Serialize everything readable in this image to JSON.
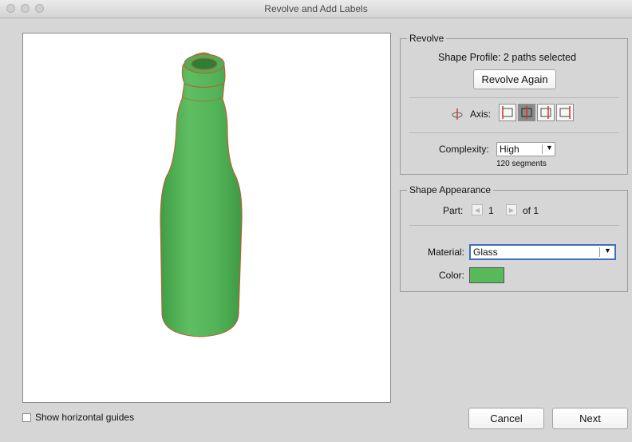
{
  "window": {
    "title": "Revolve and Add Labels"
  },
  "preview": {
    "show_guides_label": "Show horizontal guides",
    "show_guides_checked": false
  },
  "revolve": {
    "group_label": "Revolve",
    "shape_profile_text": "Shape Profile: 2 paths selected",
    "revolve_again_label": "Revolve Again",
    "axis_label": "Axis:",
    "axis_selected": 2,
    "complexity_label": "Complexity:",
    "complexity_value": "High",
    "segments_text": "120 segments"
  },
  "appearance": {
    "group_label": "Shape Appearance",
    "part_label": "Part:",
    "part_current": "1",
    "part_total_text": "of 1",
    "material_label": "Material:",
    "material_value": "Glass",
    "color_label": "Color:",
    "color_value": "#57b95a"
  },
  "buttons": {
    "cancel": "Cancel",
    "next": "Next"
  }
}
